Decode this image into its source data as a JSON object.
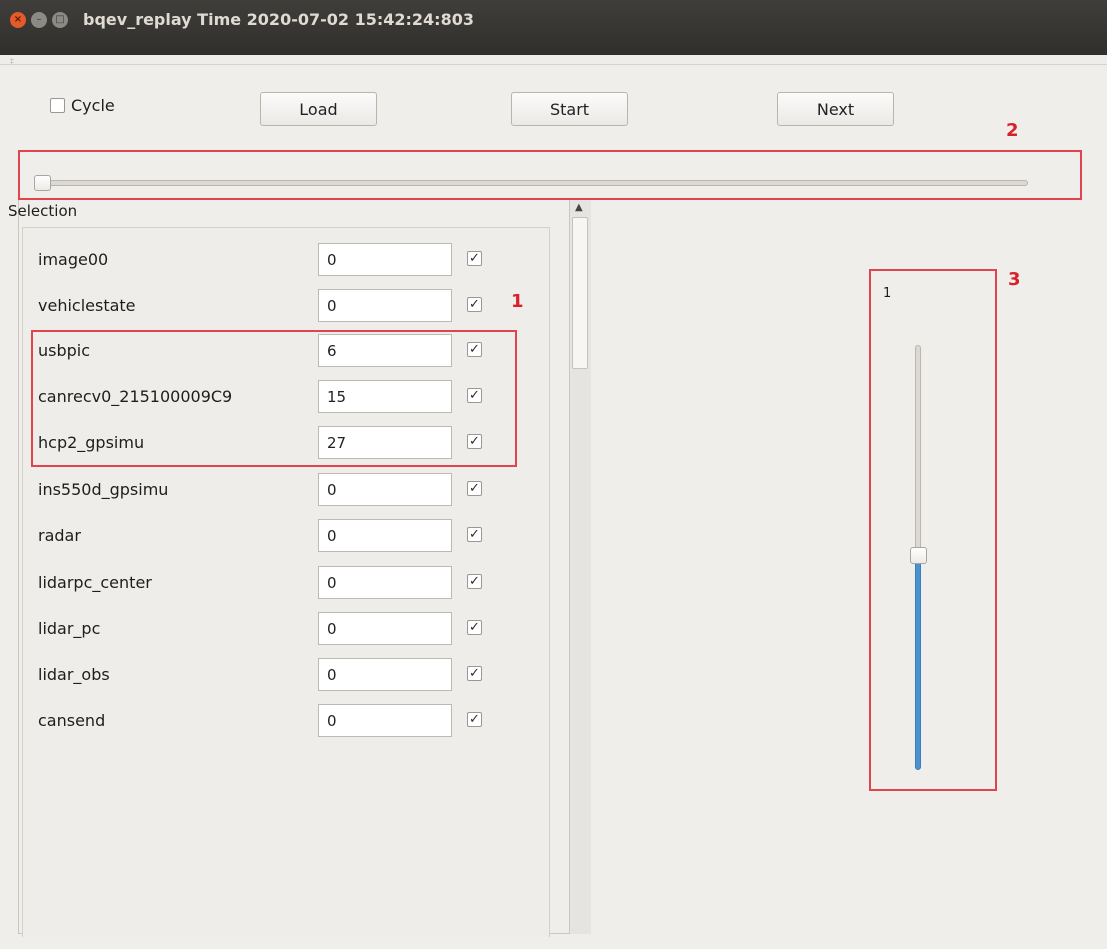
{
  "window": {
    "title": "bqev_replay Time 2020-07-02 15:42:24:803",
    "close_glyph": "×",
    "minimize_glyph": "–",
    "maximize_glyph": "□"
  },
  "toolbar": {
    "cycle_label": "Cycle",
    "cycle_checked": false,
    "load_label": "Load",
    "start_label": "Start",
    "next_label": "Next"
  },
  "timeline_slider": {
    "value_fraction": 0.0
  },
  "selection": {
    "title": "Selection",
    "check_glyph": "✓",
    "rows": [
      {
        "label": "image00",
        "value": "0",
        "checked": true
      },
      {
        "label": "vehiclestate",
        "value": "0",
        "checked": true
      },
      {
        "label": "usbpic",
        "value": "6",
        "checked": true
      },
      {
        "label": "canrecv0_215100009C9",
        "value": "15",
        "checked": true
      },
      {
        "label": "hcp2_gpsimu",
        "value": "27",
        "checked": true
      },
      {
        "label": "ins550d_gpsimu",
        "value": "0",
        "checked": true
      },
      {
        "label": "radar",
        "value": "0",
        "checked": true
      },
      {
        "label": "lidarpc_center",
        "value": "0",
        "checked": true
      },
      {
        "label": "lidar_pc",
        "value": "0",
        "checked": true
      },
      {
        "label": "lidar_obs",
        "value": "0",
        "checked": true
      },
      {
        "label": "cansend",
        "value": "0",
        "checked": true
      }
    ]
  },
  "speed_slider": {
    "label": "1",
    "value_fraction": 0.5
  },
  "annotations": {
    "label_1": "1",
    "label_2": "2",
    "label_3": "3",
    "color": "#e0454d"
  },
  "colors": {
    "titlebar": "#3a3936",
    "close_button": "#e35a2b",
    "slider_fill": "#4b93d0",
    "window_bg": "#f0eeeb"
  }
}
